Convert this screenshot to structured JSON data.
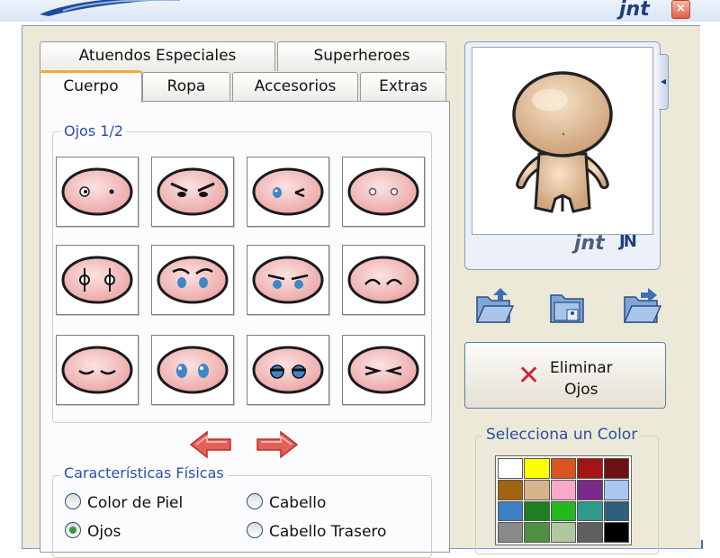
{
  "window": {
    "brand": "jnt",
    "close_label": "×"
  },
  "tabs": {
    "top_row": [
      "Atuendos Especiales",
      "Superheroes"
    ],
    "bottom_row": [
      "Cuerpo",
      "Ropa",
      "Accesorios",
      "Extras"
    ],
    "active": "Cuerpo"
  },
  "eyes_group": {
    "legend": "Ojos 1/2",
    "items": [
      {
        "style": "dots"
      },
      {
        "style": "angry"
      },
      {
        "style": "wink"
      },
      {
        "style": "small-rings"
      },
      {
        "style": "pierrot"
      },
      {
        "style": "blue-brows"
      },
      {
        "style": "blue-frown"
      },
      {
        "style": "happy-arcs"
      },
      {
        "style": "sleepy"
      },
      {
        "style": "blue-big"
      },
      {
        "style": "half-lid"
      },
      {
        "style": "squint"
      }
    ]
  },
  "nav": {
    "prev_icon": "red-arrow-left-icon",
    "next_icon": "red-arrow-right-icon"
  },
  "features": {
    "legend": "Características Físicas",
    "options": [
      {
        "label": "Color de Piel",
        "selected": false
      },
      {
        "label": "Cabello",
        "selected": false
      },
      {
        "label": "Ojos",
        "selected": true
      },
      {
        "label": "Cabello Trasero",
        "selected": false
      }
    ]
  },
  "preview": {
    "brand": "jnt",
    "badge": "JN"
  },
  "actions": {
    "open_icon": "open-folder-icon",
    "save_icon": "save-folder-icon",
    "export_icon": "export-folder-icon",
    "delete_line1": "Eliminar",
    "delete_line2": "Ojos"
  },
  "colors": {
    "legend": "Selecciona un Color",
    "palette": [
      "#ffffff",
      "#ffff00",
      "#d9541e",
      "#a31515",
      "#6b1111",
      "#a0640e",
      "#d8b48c",
      "#f9a9c8",
      "#7a2a8a",
      "#a9c8f0",
      "#3f7fc4",
      "#1e7f1e",
      "#24b81e",
      "#2f9a8a",
      "#2f5f7f",
      "#8a8a8a",
      "#4f8f3f",
      "#b0c8a0",
      "#5f5f5f",
      "#000000"
    ]
  }
}
